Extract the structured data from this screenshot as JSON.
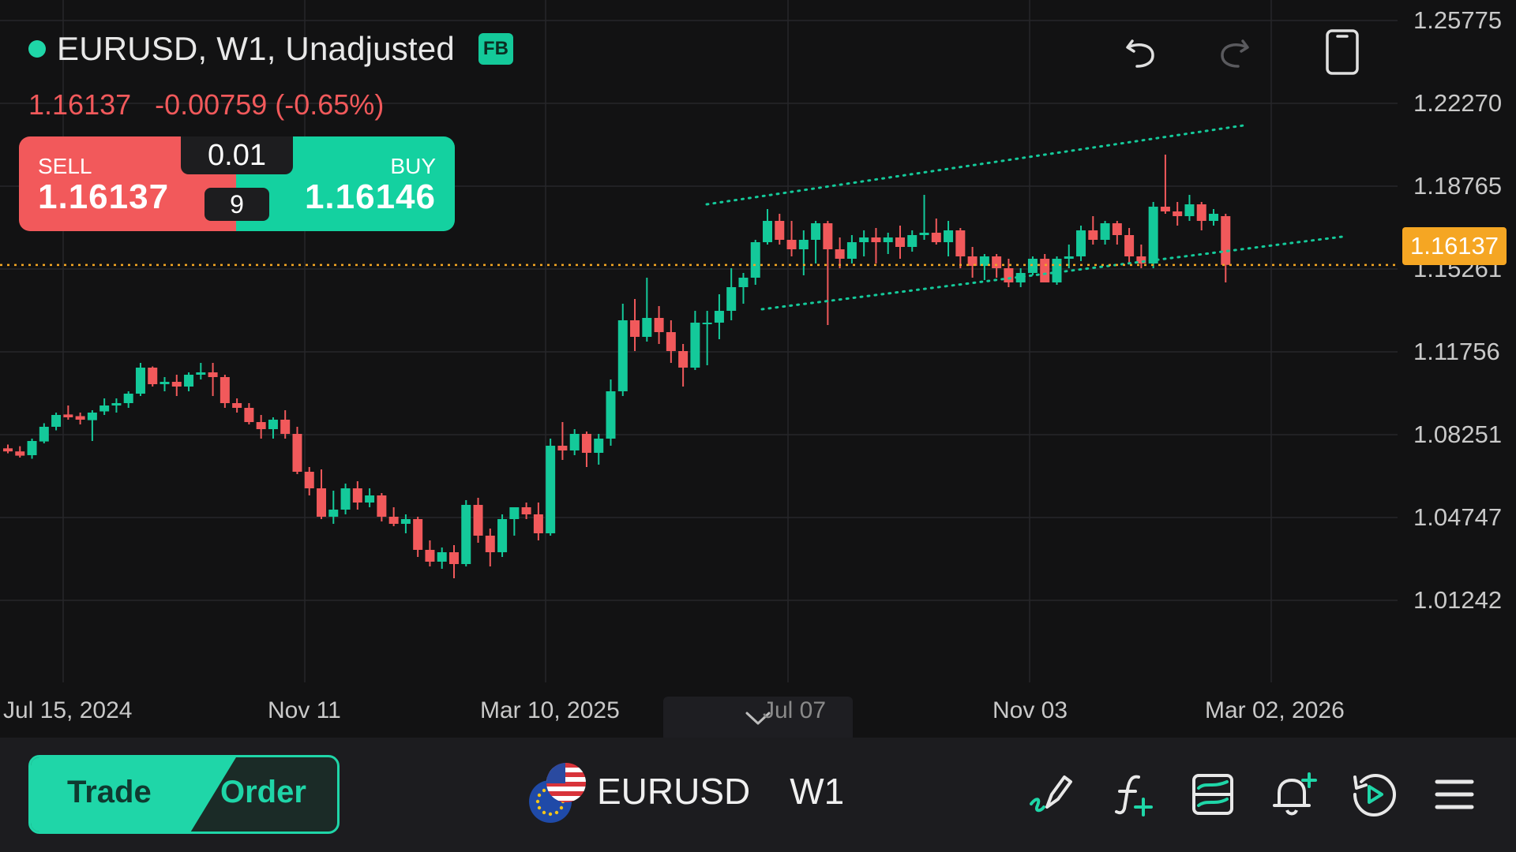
{
  "header": {
    "title": "EURUSD, W1, Unadjusted",
    "badge": "FB",
    "last_price": "1.16137",
    "change": "-0.00759 (-0.65%)"
  },
  "trade_widget": {
    "sell_label": "SELL",
    "sell_price": "1.16137",
    "buy_label": "BUY",
    "buy_price": "1.16146",
    "lot_size": "0.01",
    "spread": "9"
  },
  "toolbar_top": {
    "icons": [
      "undo-icon",
      "redo-icon",
      "device-orientation-icon"
    ]
  },
  "colors": {
    "up": "#14c99a",
    "down": "#f1595b",
    "accent": "#1fd6a8",
    "price_line": "#f5a623",
    "background": "#121213"
  },
  "price_axis": {
    "labels": [
      "1.25775",
      "1.22270",
      "1.18765",
      "1.15261",
      "1.11756",
      "1.08251",
      "1.04747",
      "1.01242"
    ],
    "current_price_tag": "1.16137"
  },
  "time_axis": {
    "labels": [
      "Jul 15, 2024",
      "Nov 11",
      "Mar 10, 2025",
      "Jul 07",
      "Nov 03",
      "Mar 02, 2026"
    ]
  },
  "chart_data": {
    "type": "candlestick",
    "symbol": "EURUSD",
    "timeframe": "W1",
    "current_price": 1.16137,
    "ylim": [
      0.985,
      1.265
    ],
    "grid": true,
    "candles": [
      [
        1.0839,
        1.0855,
        1.0818,
        1.0826
      ],
      [
        1.0826,
        1.0848,
        1.08,
        1.0808
      ],
      [
        1.081,
        1.088,
        1.0795,
        1.087
      ],
      [
        1.0868,
        1.0945,
        1.086,
        1.093
      ],
      [
        1.093,
        1.099,
        1.0915,
        1.098
      ],
      [
        1.0982,
        1.102,
        1.096,
        1.097
      ],
      [
        1.0975,
        1.099,
        1.094,
        1.096
      ],
      [
        1.0958,
        1.1,
        1.087,
        1.099
      ],
      [
        1.0995,
        1.105,
        1.098,
        1.102
      ],
      [
        1.102,
        1.105,
        1.099,
        1.103
      ],
      [
        1.103,
        1.108,
        1.101,
        1.107
      ],
      [
        1.107,
        1.12,
        1.106,
        1.118
      ],
      [
        1.118,
        1.1185,
        1.11,
        1.111
      ],
      [
        1.111,
        1.114,
        1.108,
        1.112
      ],
      [
        1.112,
        1.115,
        1.106,
        1.11
      ],
      [
        1.11,
        1.116,
        1.108,
        1.115
      ],
      [
        1.115,
        1.12,
        1.113,
        1.116
      ],
      [
        1.116,
        1.12,
        1.106,
        1.114
      ],
      [
        1.114,
        1.115,
        1.101,
        1.103
      ],
      [
        1.103,
        1.105,
        1.099,
        1.101
      ],
      [
        1.101,
        1.103,
        1.094,
        1.095
      ],
      [
        1.095,
        1.098,
        1.088,
        1.092
      ],
      [
        1.092,
        1.097,
        1.088,
        1.096
      ],
      [
        1.096,
        1.1,
        1.088,
        1.09
      ],
      [
        1.09,
        1.093,
        1.073,
        1.074
      ],
      [
        1.074,
        1.076,
        1.064,
        1.067
      ],
      [
        1.067,
        1.075,
        1.054,
        1.055
      ],
      [
        1.055,
        1.066,
        1.052,
        1.058
      ],
      [
        1.058,
        1.069,
        1.056,
        1.067
      ],
      [
        1.067,
        1.07,
        1.058,
        1.061
      ],
      [
        1.061,
        1.067,
        1.059,
        1.064
      ],
      [
        1.064,
        1.065,
        1.053,
        1.055
      ],
      [
        1.055,
        1.059,
        1.051,
        1.052
      ],
      [
        1.052,
        1.056,
        1.048,
        1.054
      ],
      [
        1.054,
        1.055,
        1.038,
        1.041
      ],
      [
        1.041,
        1.045,
        1.034,
        1.036
      ],
      [
        1.036,
        1.042,
        1.033,
        1.04
      ],
      [
        1.04,
        1.043,
        1.029,
        1.035
      ],
      [
        1.035,
        1.062,
        1.034,
        1.06
      ],
      [
        1.06,
        1.063,
        1.044,
        1.047
      ],
      [
        1.047,
        1.05,
        1.034,
        1.04
      ],
      [
        1.04,
        1.056,
        1.038,
        1.054
      ],
      [
        1.054,
        1.059,
        1.047,
        1.059
      ],
      [
        1.059,
        1.061,
        1.054,
        1.056
      ],
      [
        1.056,
        1.061,
        1.045,
        1.048
      ],
      [
        1.048,
        1.088,
        1.047,
        1.085
      ],
      [
        1.085,
        1.095,
        1.079,
        1.083
      ],
      [
        1.083,
        1.092,
        1.081,
        1.09
      ],
      [
        1.09,
        1.091,
        1.076,
        1.082
      ],
      [
        1.082,
        1.09,
        1.077,
        1.088
      ],
      [
        1.088,
        1.113,
        1.085,
        1.108
      ],
      [
        1.108,
        1.145,
        1.106,
        1.138
      ],
      [
        1.138,
        1.147,
        1.125,
        1.131
      ],
      [
        1.131,
        1.156,
        1.129,
        1.139
      ],
      [
        1.139,
        1.144,
        1.128,
        1.133
      ],
      [
        1.133,
        1.138,
        1.12,
        1.125
      ],
      [
        1.125,
        1.128,
        1.11,
        1.118
      ],
      [
        1.118,
        1.142,
        1.117,
        1.137
      ],
      [
        1.137,
        1.142,
        1.119,
        1.137
      ],
      [
        1.137,
        1.149,
        1.13,
        1.142
      ],
      [
        1.142,
        1.16,
        1.138,
        1.152
      ],
      [
        1.152,
        1.158,
        1.145,
        1.156
      ],
      [
        1.156,
        1.172,
        1.153,
        1.171
      ],
      [
        1.171,
        1.185,
        1.17,
        1.18
      ],
      [
        1.18,
        1.183,
        1.17,
        1.172
      ],
      [
        1.172,
        1.18,
        1.165,
        1.168
      ],
      [
        1.168,
        1.176,
        1.157,
        1.172
      ],
      [
        1.172,
        1.18,
        1.162,
        1.179
      ],
      [
        1.179,
        1.18,
        1.136,
        1.168
      ],
      [
        1.168,
        1.173,
        1.16,
        1.164
      ],
      [
        1.164,
        1.174,
        1.162,
        1.171
      ],
      [
        1.171,
        1.176,
        1.165,
        1.173
      ],
      [
        1.173,
        1.177,
        1.162,
        1.171
      ],
      [
        1.171,
        1.175,
        1.166,
        1.173
      ],
      [
        1.173,
        1.178,
        1.164,
        1.169
      ],
      [
        1.169,
        1.176,
        1.167,
        1.174
      ],
      [
        1.174,
        1.191,
        1.172,
        1.175
      ],
      [
        1.175,
        1.181,
        1.17,
        1.171
      ],
      [
        1.171,
        1.18,
        1.165,
        1.176
      ],
      [
        1.176,
        1.177,
        1.16,
        1.165
      ],
      [
        1.165,
        1.169,
        1.156,
        1.161
      ],
      [
        1.161,
        1.166,
        1.155,
        1.165
      ],
      [
        1.165,
        1.166,
        1.156,
        1.16
      ],
      [
        1.16,
        1.164,
        1.152,
        1.154
      ],
      [
        1.154,
        1.16,
        1.152,
        1.158
      ],
      [
        1.158,
        1.165,
        1.157,
        1.164
      ],
      [
        1.164,
        1.166,
        1.154,
        1.154
      ],
      [
        1.154,
        1.165,
        1.153,
        1.164
      ],
      [
        1.164,
        1.17,
        1.16,
        1.165
      ],
      [
        1.165,
        1.178,
        1.163,
        1.176
      ],
      [
        1.176,
        1.182,
        1.17,
        1.172
      ],
      [
        1.172,
        1.18,
        1.17,
        1.179
      ],
      [
        1.179,
        1.18,
        1.17,
        1.174
      ],
      [
        1.174,
        1.177,
        1.162,
        1.165
      ],
      [
        1.165,
        1.17,
        1.16,
        1.162
      ],
      [
        1.162,
        1.188,
        1.16,
        1.186
      ],
      [
        1.186,
        1.208,
        1.183,
        1.184
      ],
      [
        1.184,
        1.188,
        1.178,
        1.182
      ],
      [
        1.182,
        1.191,
        1.18,
        1.187
      ],
      [
        1.187,
        1.188,
        1.176,
        1.18
      ],
      [
        1.18,
        1.185,
        1.178,
        1.183
      ],
      [
        1.182,
        1.183,
        1.154,
        1.1614
      ]
    ]
  }
}
